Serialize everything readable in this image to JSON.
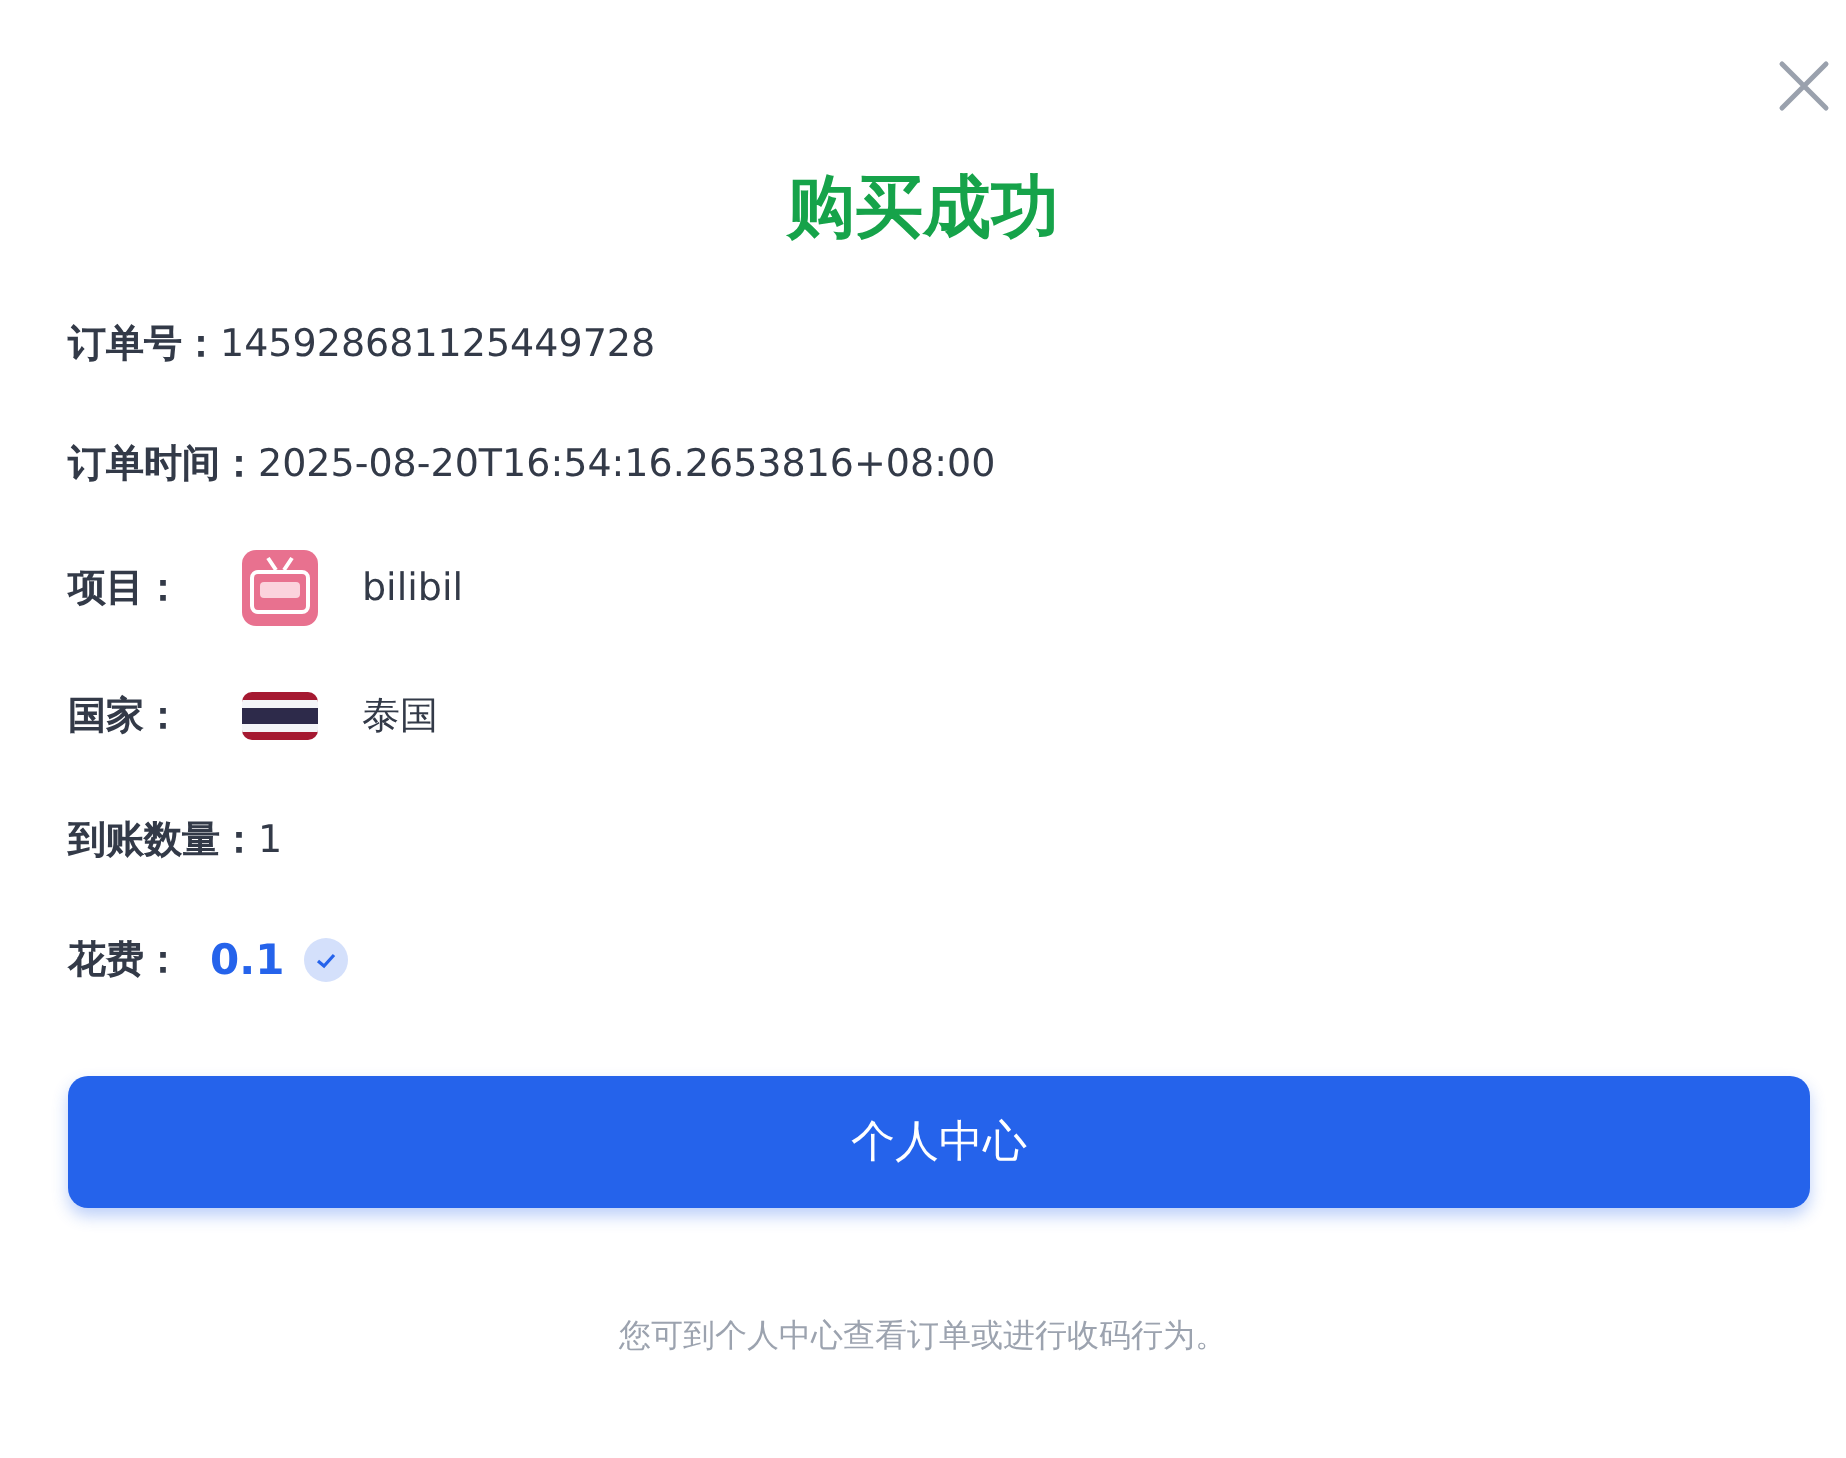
{
  "dialog": {
    "title": "购买成功",
    "fields": [
      {
        "kind": "text",
        "label": "订单号：",
        "value": "145928681125449728"
      },
      {
        "kind": "text",
        "label": "订单时间：",
        "value": "2025-08-20T16:54:16.2653816+08:00"
      },
      {
        "kind": "app",
        "label": "项目：",
        "value": "bilibil"
      },
      {
        "kind": "flag",
        "label": "国家：",
        "value": "泰国"
      },
      {
        "kind": "text",
        "label": "到账数量：",
        "value": "1"
      },
      {
        "kind": "price",
        "label": "花费：",
        "value": "0.1"
      }
    ],
    "button": "个人中心",
    "note": "您可到个人中心查看订单或进行收码行为。"
  }
}
